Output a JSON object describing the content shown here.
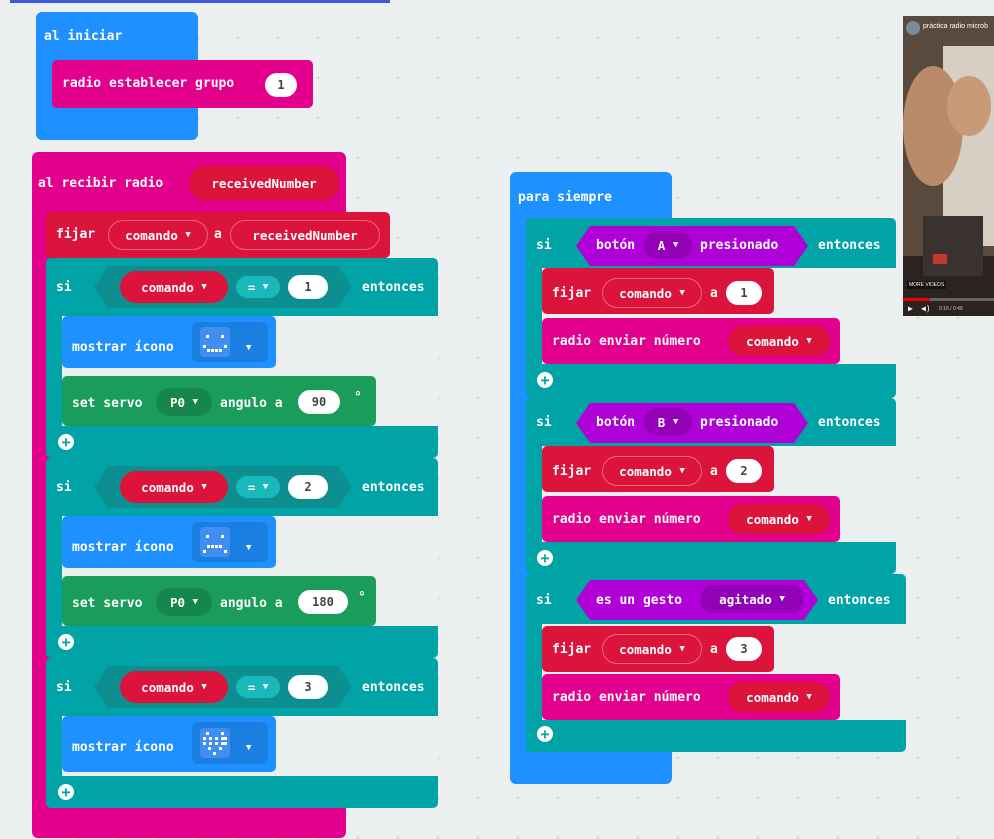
{
  "on_start": {
    "header": "al iniciar",
    "radio_set_group": "radio establecer grupo",
    "group_value": "1"
  },
  "on_received": {
    "header": "al recibir radio",
    "param": "receivedNumber",
    "set_label": "fijar",
    "set_var": "comando",
    "set_to": "a",
    "set_value": "receivedNumber",
    "if_blocks": [
      {
        "si": "si",
        "var": "comando",
        "op": "=",
        "value": "1",
        "then": "entonces",
        "show_icon": "mostrar ícono",
        "has_servo": true,
        "servo_label": "set servo",
        "servo_pin": "P0",
        "servo_angle_label": "angulo a",
        "servo_value": "90",
        "degree": "°"
      },
      {
        "si": "si",
        "var": "comando",
        "op": "=",
        "value": "2",
        "then": "entonces",
        "show_icon": "mostrar ícono",
        "has_servo": true,
        "servo_label": "set servo",
        "servo_pin": "P0",
        "servo_angle_label": "angulo a",
        "servo_value": "180",
        "degree": "°"
      },
      {
        "si": "si",
        "var": "comando",
        "op": "=",
        "value": "3",
        "then": "entonces",
        "show_icon": "mostrar ícono",
        "has_servo": false
      }
    ]
  },
  "forever": {
    "header": "para siempre",
    "if_blocks": [
      {
        "si": "si",
        "cond_prefix": "botón",
        "cond_option": "A",
        "cond_suffix": "presionado",
        "then": "entonces",
        "set_label": "fijar",
        "set_var": "comando",
        "set_to": "a",
        "set_value": "1",
        "send_label": "radio enviar número",
        "send_var": "comando"
      },
      {
        "si": "si",
        "cond_prefix": "botón",
        "cond_option": "B",
        "cond_suffix": "presionado",
        "then": "entonces",
        "set_label": "fijar",
        "set_var": "comando",
        "set_to": "a",
        "set_value": "2",
        "send_label": "radio enviar número",
        "send_var": "comando"
      },
      {
        "si": "si",
        "cond_prefix": "es un gesto",
        "cond_option": "agitado",
        "cond_suffix": "",
        "then": "entonces",
        "set_label": "fijar",
        "set_var": "comando",
        "set_to": "a",
        "set_value": "3",
        "send_label": "radio enviar número",
        "send_var": "comando"
      }
    ]
  },
  "video": {
    "title": "práctica radio microb",
    "more_videos": "MORE VIDEOS",
    "time": "0:16 / 0:49"
  },
  "colors": {
    "event": "#1e90ff",
    "radio": "#e3008c",
    "variable": "#dc143c",
    "logic": "#00a4a6",
    "servo": "#1a9c5a",
    "input": "#b000d8",
    "workspace": "#ecf0f1"
  },
  "icons": [
    "plus-circle-icon",
    "dropdown-caret-icon",
    "led-matrix-icon",
    "play-icon",
    "volume-icon",
    "channel-avatar-icon"
  ]
}
